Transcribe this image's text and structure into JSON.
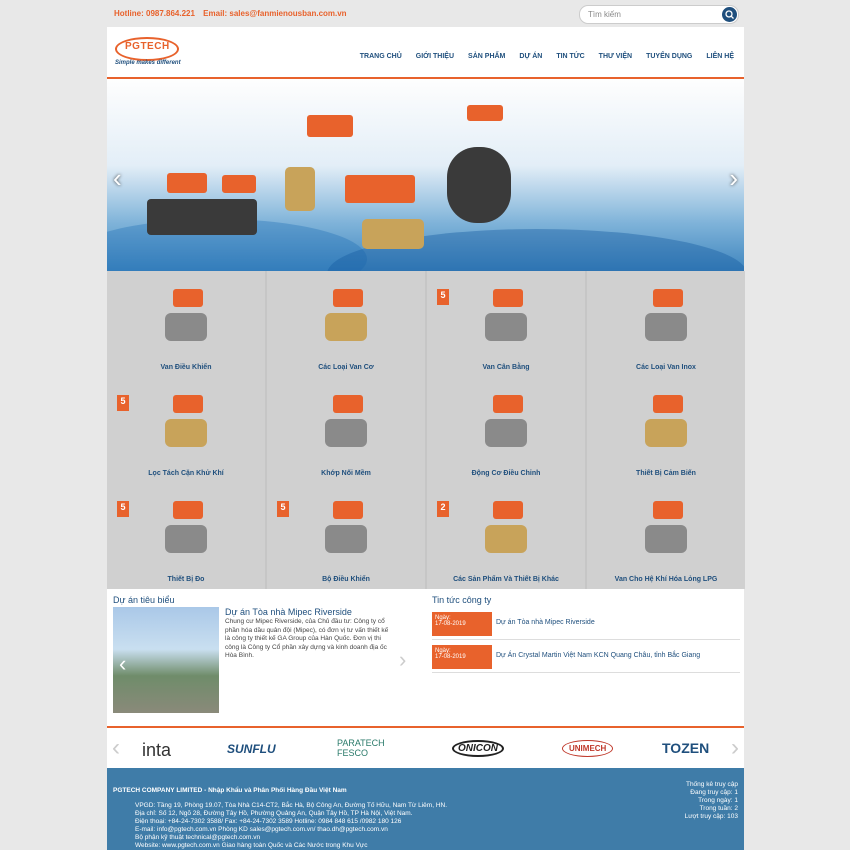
{
  "topbar": {
    "hotline": "Hotline: 0987.864.221",
    "email": "Email: sales@fanmienousban.com.vn",
    "search_placeholder": "Tìm kiếm"
  },
  "logo": {
    "text": "PGTECH",
    "slogan": "Simple makes different"
  },
  "nav": [
    "TRANG CHỦ",
    "GIỚI THIỆU",
    "SẢN PHẨM",
    "DỰ ÁN",
    "TIN TỨC",
    "THƯ VIỆN",
    "TUYỂN DỤNG",
    "LIÊN HỆ"
  ],
  "hero": {
    "prev": "‹",
    "next": "›"
  },
  "products": [
    {
      "label": "Van Điều Khiển"
    },
    {
      "label": "Các Loại Van Cơ"
    },
    {
      "label": "Van Cân Bằng",
      "badge": "5"
    },
    {
      "label": "Các Loại Van Inox"
    },
    {
      "label": "Lọc Tách Cặn Khử Khí",
      "badge": "5"
    },
    {
      "label": "Khớp Nối Mềm"
    },
    {
      "label": "Động Cơ Điều Chỉnh"
    },
    {
      "label": "Thiết Bị Cảm Biến"
    },
    {
      "label": "Thiết Bị Đo",
      "badge": "5"
    },
    {
      "label": "Bộ Điều Khiển",
      "badge": "5"
    },
    {
      "label": "Các Sản Phẩm Và Thiết Bị Khác",
      "badge": "2"
    },
    {
      "label": "Van Cho Hệ Khí Hóa Lỏng LPG"
    }
  ],
  "projects": {
    "heading": "Dự án tiêu biểu",
    "title": "Dự án Tòa nhà Mipec Riverside",
    "desc": "Chung cư Mipec Riverside, của Chủ đầu tư: Công ty cổ phần hóa dầu quân đội (Mipec), có đơn vị tư vấn thiết kế là công ty thiết kế GA Group của Hàn Quốc. Đơn vị thi công là Công ty Cổ phần xây dựng và kinh doanh địa ốc Hòa Bình."
  },
  "news": {
    "heading": "Tin tức công ty",
    "items": [
      {
        "date_label": "Ngày:",
        "date": "17-08-2019",
        "title": "Dự án Tòa nhà Mipec Riverside"
      },
      {
        "date_label": "Ngày:",
        "date": "17-08-2019",
        "title": "Dự Án Crystal Martin Việt Nam KCN Quang Châu, tỉnh Bắc Giang"
      }
    ]
  },
  "partners": [
    "inta",
    "SUNFLU",
    "PARATECH FESCO",
    "ONICON",
    "UNIMECH",
    "TOZEN"
  ],
  "footer": {
    "company": "PGTECH COMPANY LIMITED - Nhập Khẩu và Phân Phối Hàng Đầu Việt Nam",
    "lines": [
      "VPGD: Tầng 19, Phòng 19.07, Tòa Nhà C14-CT2, Bắc Hà, Bộ Công An, Đường Tố Hữu, Nam Từ Liêm, HN.",
      "Địa chỉ: Số 12, Ngõ 28, Đường Tây Hồ, Phường Quảng An, Quận Tây Hồ, TP Hà Nội, Việt Nam.",
      "Điện thoại: +84-24-7302 3588/ Fax: +84-24-7302 3589 Hotline: 0984 848 615 /0982 180 126",
      "E-mail: info@pgtech.com.vn Phòng KD sales@pgtech.com.vn/ thao.dh@pgtech.com.vn",
      "Bộ phận kỹ thuật technical@pgtech.com.vn",
      "Website: www.pgtech.com.vn Giao hàng toàn Quốc và Các Nước trong Khu Vực"
    ],
    "stats_title": "Thống kê truy cập",
    "stats": [
      "Đang truy cập: 1",
      "Trong ngày: 1",
      "Trong tuần: 2",
      "Lượt truy cập: 103"
    ]
  },
  "colors": {
    "accent": "#e8622c",
    "brand": "#1f4f7d",
    "footer": "#3f7ca8"
  }
}
